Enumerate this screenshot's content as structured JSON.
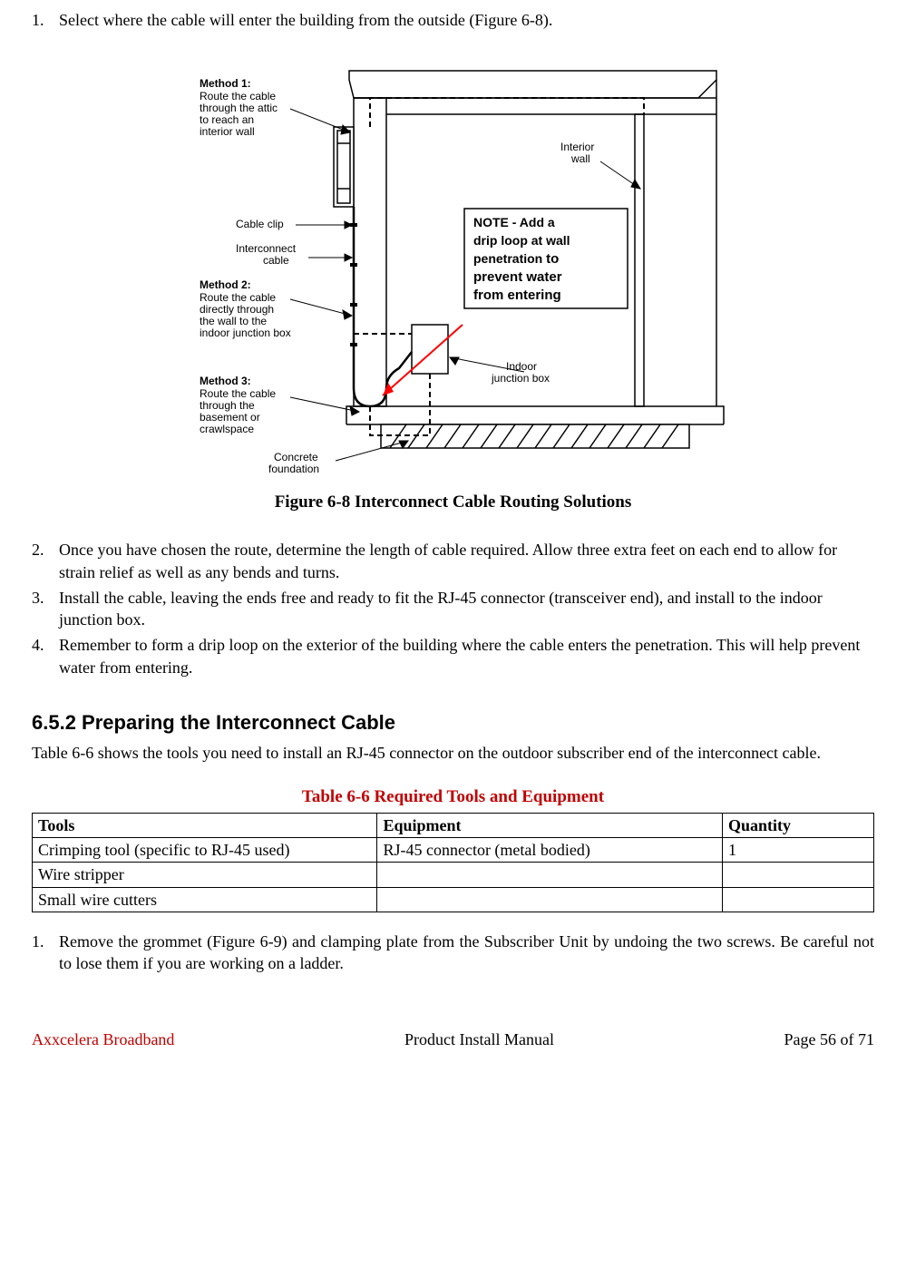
{
  "steps_top": [
    {
      "num": "1.",
      "text": "Select where the cable will enter the building from the outside (Figure 6-8)."
    }
  ],
  "figure": {
    "caption": "Figure 6-8 Interconnect Cable Routing Solutions",
    "labels": {
      "method1_title": "Method 1:",
      "method1_text": "Route the cable through the attic to reach an interior wall",
      "cable_clip": "Cable clip",
      "interconnect_cable": "Interconnect cable",
      "method2_title": "Method 2:",
      "method2_text": "Route the cable directly through the wall to  the indoor  junction box",
      "method3_title": "Method 3:",
      "method3_text": "Route the cable through the basement or crawlspace",
      "concrete_foundation": "Concrete foundation",
      "interior_wall": "Interior wall",
      "note_line1": "NOTE - Add a",
      "note_line2": "drip loop at wall",
      "note_line3": "penetration ",
      "note_line3b": "to",
      "note_line4": "prevent water",
      "note_line5": "from entering",
      "indoor_jbox": "Indoor junction box"
    }
  },
  "steps_after_fig": [
    {
      "num": "2.",
      "text": "Once you have chosen the route, determine the length of cable required.  Allow three extra feet on each end to allow for strain relief as well as any bends and turns."
    },
    {
      "num": "3.",
      "text": "Install the cable, leaving the ends free and ready to fit the RJ-45 connector (transceiver end), and install to the indoor junction box."
    },
    {
      "num": "4.",
      "text": "Remember to form a drip loop on the exterior of the building where the cable enters the penetration.  This will help prevent water from entering."
    }
  ],
  "section": {
    "heading": "6.5.2  Preparing the Interconnect Cable",
    "intro": "Table 6-6 shows the tools you need to install an RJ-45 connector on the outdoor subscriber end of the interconnect cable."
  },
  "table": {
    "caption": "Table 6-6 Required Tools and Equipment",
    "headers": {
      "tools": "Tools",
      "equipment": "Equipment",
      "quantity": "Quantity"
    },
    "rows": [
      {
        "tool": "Crimping tool (specific to RJ-45 used)",
        "equipment": "RJ-45 connector (metal bodied)",
        "qty": "1"
      },
      {
        "tool": "Wire stripper",
        "equipment": "",
        "qty": ""
      },
      {
        "tool": "Small wire cutters",
        "equipment": "",
        "qty": ""
      }
    ]
  },
  "step_bottom": {
    "num": "1.",
    "text": "Remove the grommet (Figure 6-9) and clamping plate from the Subscriber Unit by undoing the two screws.  Be careful not to lose them if you are working on a ladder."
  },
  "footer": {
    "left": "Axxcelera Broadband",
    "center": "Product Install Manual",
    "right": "Page 56 of 71"
  }
}
